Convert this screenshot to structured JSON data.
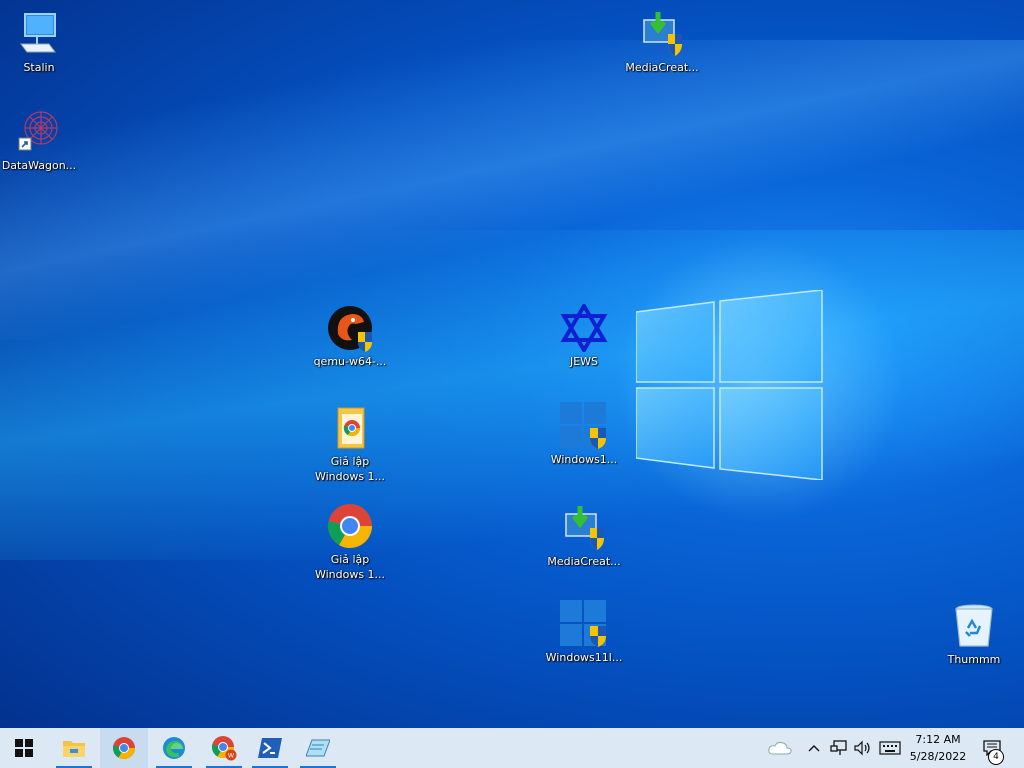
{
  "desktop": {
    "icons": [
      {
        "id": "stalin",
        "label": "Stalin",
        "icon": "computer-icon"
      },
      {
        "id": "datawagon",
        "label": "DataWagon...",
        "icon": "datawagon-app-icon"
      },
      {
        "id": "mediacreation-top",
        "label": "MediaCreat...",
        "icon": "media-creation-tool-icon"
      },
      {
        "id": "qemu",
        "label": "qemu-w64-...",
        "icon": "qemu-icon"
      },
      {
        "id": "jews",
        "label": "JEWS",
        "icon": "star-of-david-icon"
      },
      {
        "id": "gialap-folder",
        "label": "Giả lập\nWindows 1...",
        "icon": "folder-icon"
      },
      {
        "id": "windows1",
        "label": "Windows1...",
        "icon": "windows-installer-icon"
      },
      {
        "id": "gialap-chrome",
        "label": "Giả lập\nWindows 1...",
        "icon": "chrome-icon"
      },
      {
        "id": "mediacreation-mid",
        "label": "MediaCreat...",
        "icon": "media-creation-tool-icon"
      },
      {
        "id": "windows11",
        "label": "Windows11l...",
        "icon": "windows-installer-icon"
      },
      {
        "id": "recycle",
        "label": "Thummm",
        "icon": "recycle-bin-icon"
      }
    ]
  },
  "taskbar": {
    "apps": [
      "start-icon",
      "file-explorer-icon",
      "chrome-icon",
      "edge-icon",
      "chrome-profile-icon",
      "powershell-icon",
      "notepad-icon"
    ],
    "tray": [
      "onedrive-icon",
      "chevron-up-icon",
      "network-icon",
      "volume-icon",
      "keyboard-icon"
    ],
    "clock": {
      "time": "7:12 AM",
      "date": "5/28/2022"
    },
    "notifications": {
      "count": "4"
    }
  },
  "colors": {
    "accent": "#0a66d8",
    "taskbar": "#dce8f3"
  }
}
